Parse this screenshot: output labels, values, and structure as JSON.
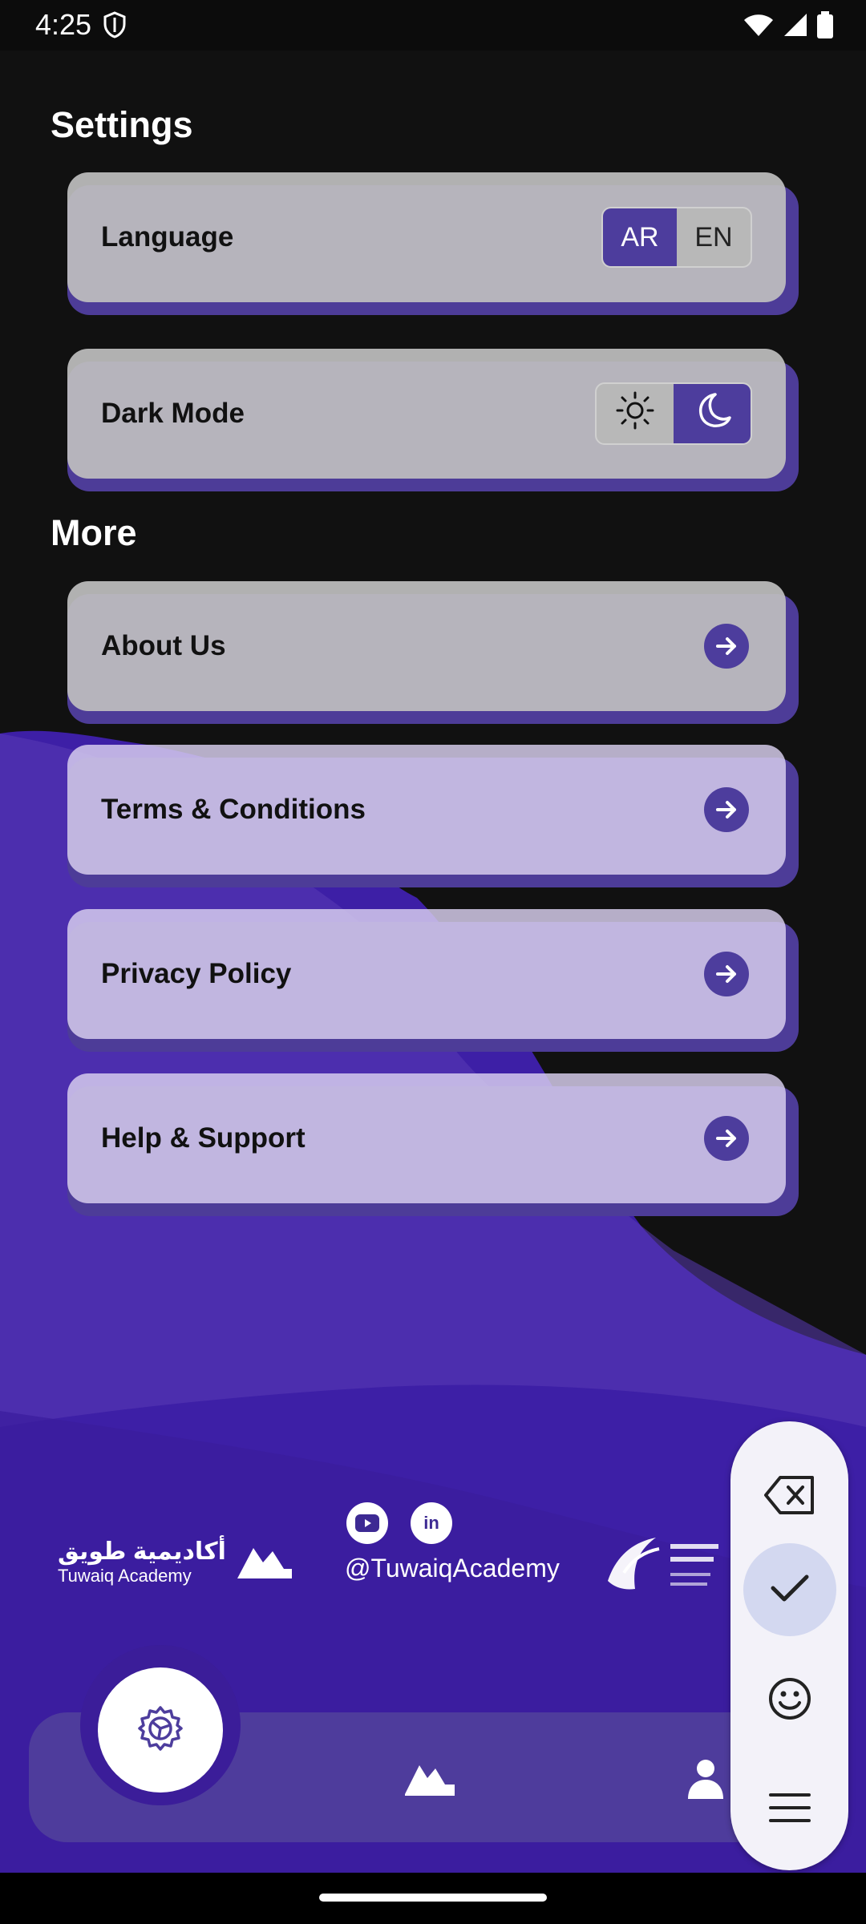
{
  "status": {
    "time": "4:25"
  },
  "sections": {
    "settings_title": "Settings",
    "more_title": "More"
  },
  "settings": {
    "language": {
      "label": "Language",
      "options": [
        "AR",
        "EN"
      ],
      "selected": "AR"
    },
    "dark_mode": {
      "label": "Dark Mode",
      "options": [
        "sun-icon",
        "moon-icon"
      ],
      "selected": "moon-icon"
    }
  },
  "more": {
    "items": [
      {
        "label": "About Us"
      },
      {
        "label": "Terms & Conditions"
      },
      {
        "label": "Privacy Policy"
      },
      {
        "label": "Help & Support"
      }
    ]
  },
  "footer": {
    "left_logo_ar": "أكاديمية طويق",
    "left_logo_en": "Tuwaiq Academy",
    "social_handle": "@TuwaiqAcademy",
    "social_icons": [
      "youtube-icon",
      "linkedin-icon"
    ]
  },
  "bottom_nav": {
    "items": [
      "settings-icon",
      "home-logo-icon",
      "profile-icon"
    ],
    "active": "settings-icon"
  },
  "tool_panel": {
    "tools": [
      "backspace-icon",
      "check-icon",
      "emoji-icon",
      "menu-icon"
    ],
    "selected": "check-icon"
  },
  "colors": {
    "accent": "#4d3d9d",
    "card": "#bfbfbf",
    "background": "#111111",
    "purple_bg": "#3d1fa6"
  }
}
